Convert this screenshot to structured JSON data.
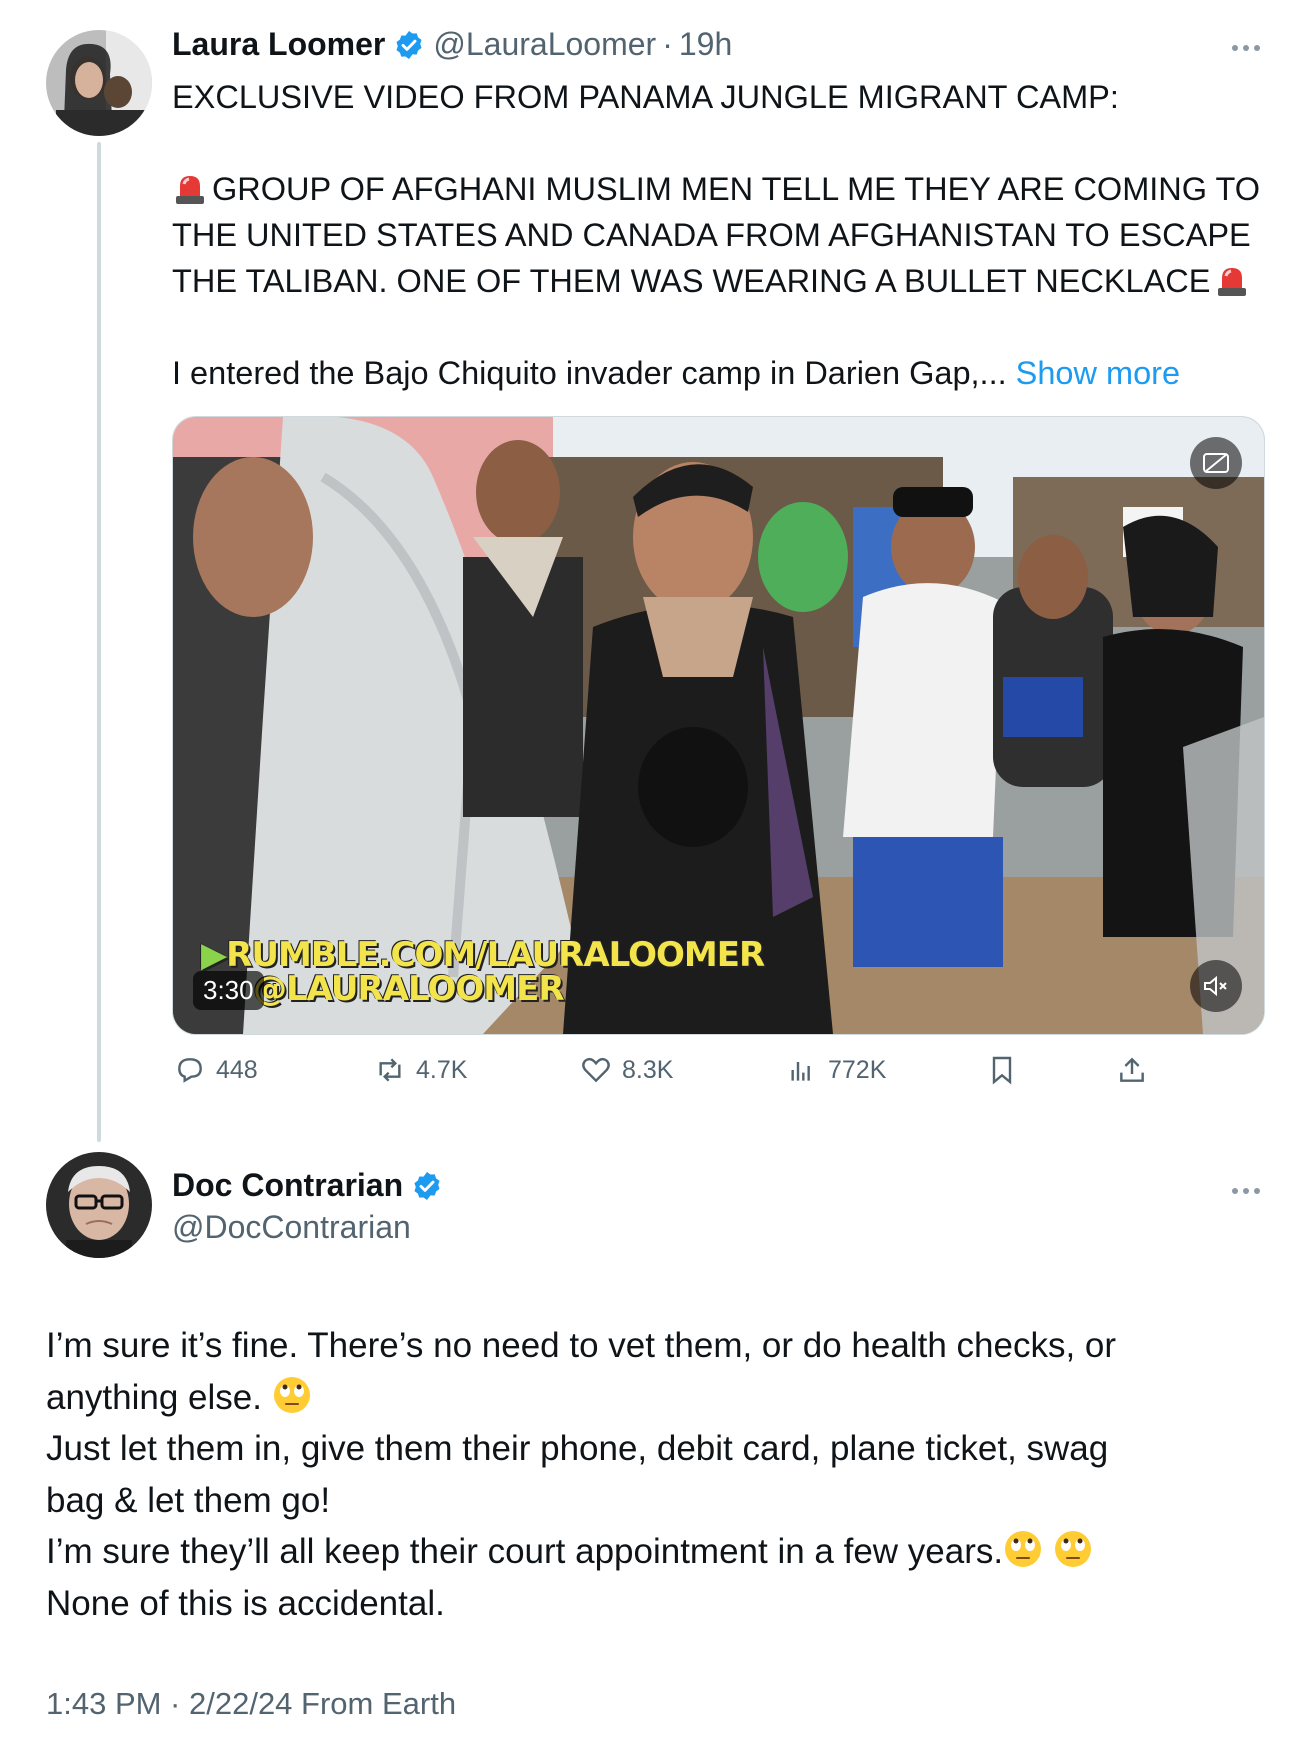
{
  "post": {
    "author_name": "Laura Loomer",
    "handle": "@LauraLoomer",
    "separator": "·",
    "time": "19h",
    "lines": [
      "EXCLUSIVE VIDEO FROM PANAMA JUNGLE MIGRANT CAMP:",
      "GROUP OF AFGHANI MUSLIM MEN TELL ME THEY ARE COMING TO",
      "THE UNITED STATES AND CANADA FROM AFGHANISTAN TO ESCAPE",
      "THE TALIBAN. ONE OF THEM WAS WEARING A BULLET NECKLACE",
      "I entered the Bajo Chiquito invader camp in Darien Gap,..."
    ],
    "show_more": "Show more",
    "media": {
      "watermark_line1": "RUMBLE.COM/LAURALOOMER",
      "watermark_line2": "@LAURALOOMER",
      "duration": "3:30"
    },
    "actions": {
      "replies": "448",
      "reposts": "4.7K",
      "likes": "8.3K",
      "views": "772K"
    }
  },
  "reply": {
    "author_name": "Doc Contrarian",
    "handle": "@DocContrarian",
    "lines": [
      "I’m sure it’s fine. There’s no need to vet them, or do health checks, or",
      "anything else.",
      "Just let them in, give them their phone, debit card, plane ticket, swag",
      "bag & let them go!",
      "I’m sure they’ll all keep their court appointment in a few years.",
      "None of this is accidental."
    ],
    "timestamp": "1:43 PM · 2/22/24 From Earth"
  },
  "colors": {
    "verified": "#1d9bf0",
    "link": "#1d9bf0",
    "secondary_text": "#536471"
  }
}
